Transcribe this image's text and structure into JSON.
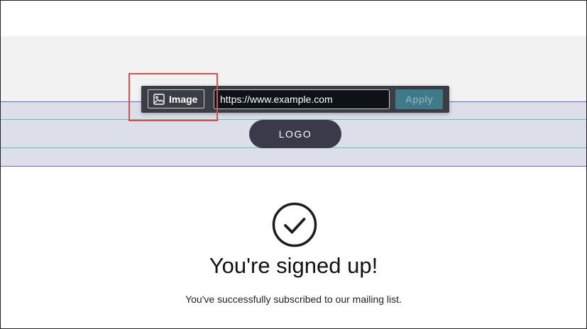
{
  "toolbar": {
    "image_button_label": "Image",
    "url_value": "https://www.example.com",
    "apply_label": "Apply"
  },
  "logo": {
    "label": "LOGO"
  },
  "confirmation": {
    "title": "You're signed up!",
    "message": "You've successfully subscribed to our mailing list."
  },
  "icons": {
    "image_button": "image-icon",
    "confirmation": "checkmark-circle-icon"
  },
  "colors": {
    "toolbar_bg": "#3a3d44",
    "apply_bg": "#3f7a8a",
    "logo_bg": "#3a3a4a",
    "section_bg": "#dcdee9",
    "section_border": "#6a62c9",
    "guide_line": "#5fc4a8",
    "highlight": "#e04b4b"
  }
}
